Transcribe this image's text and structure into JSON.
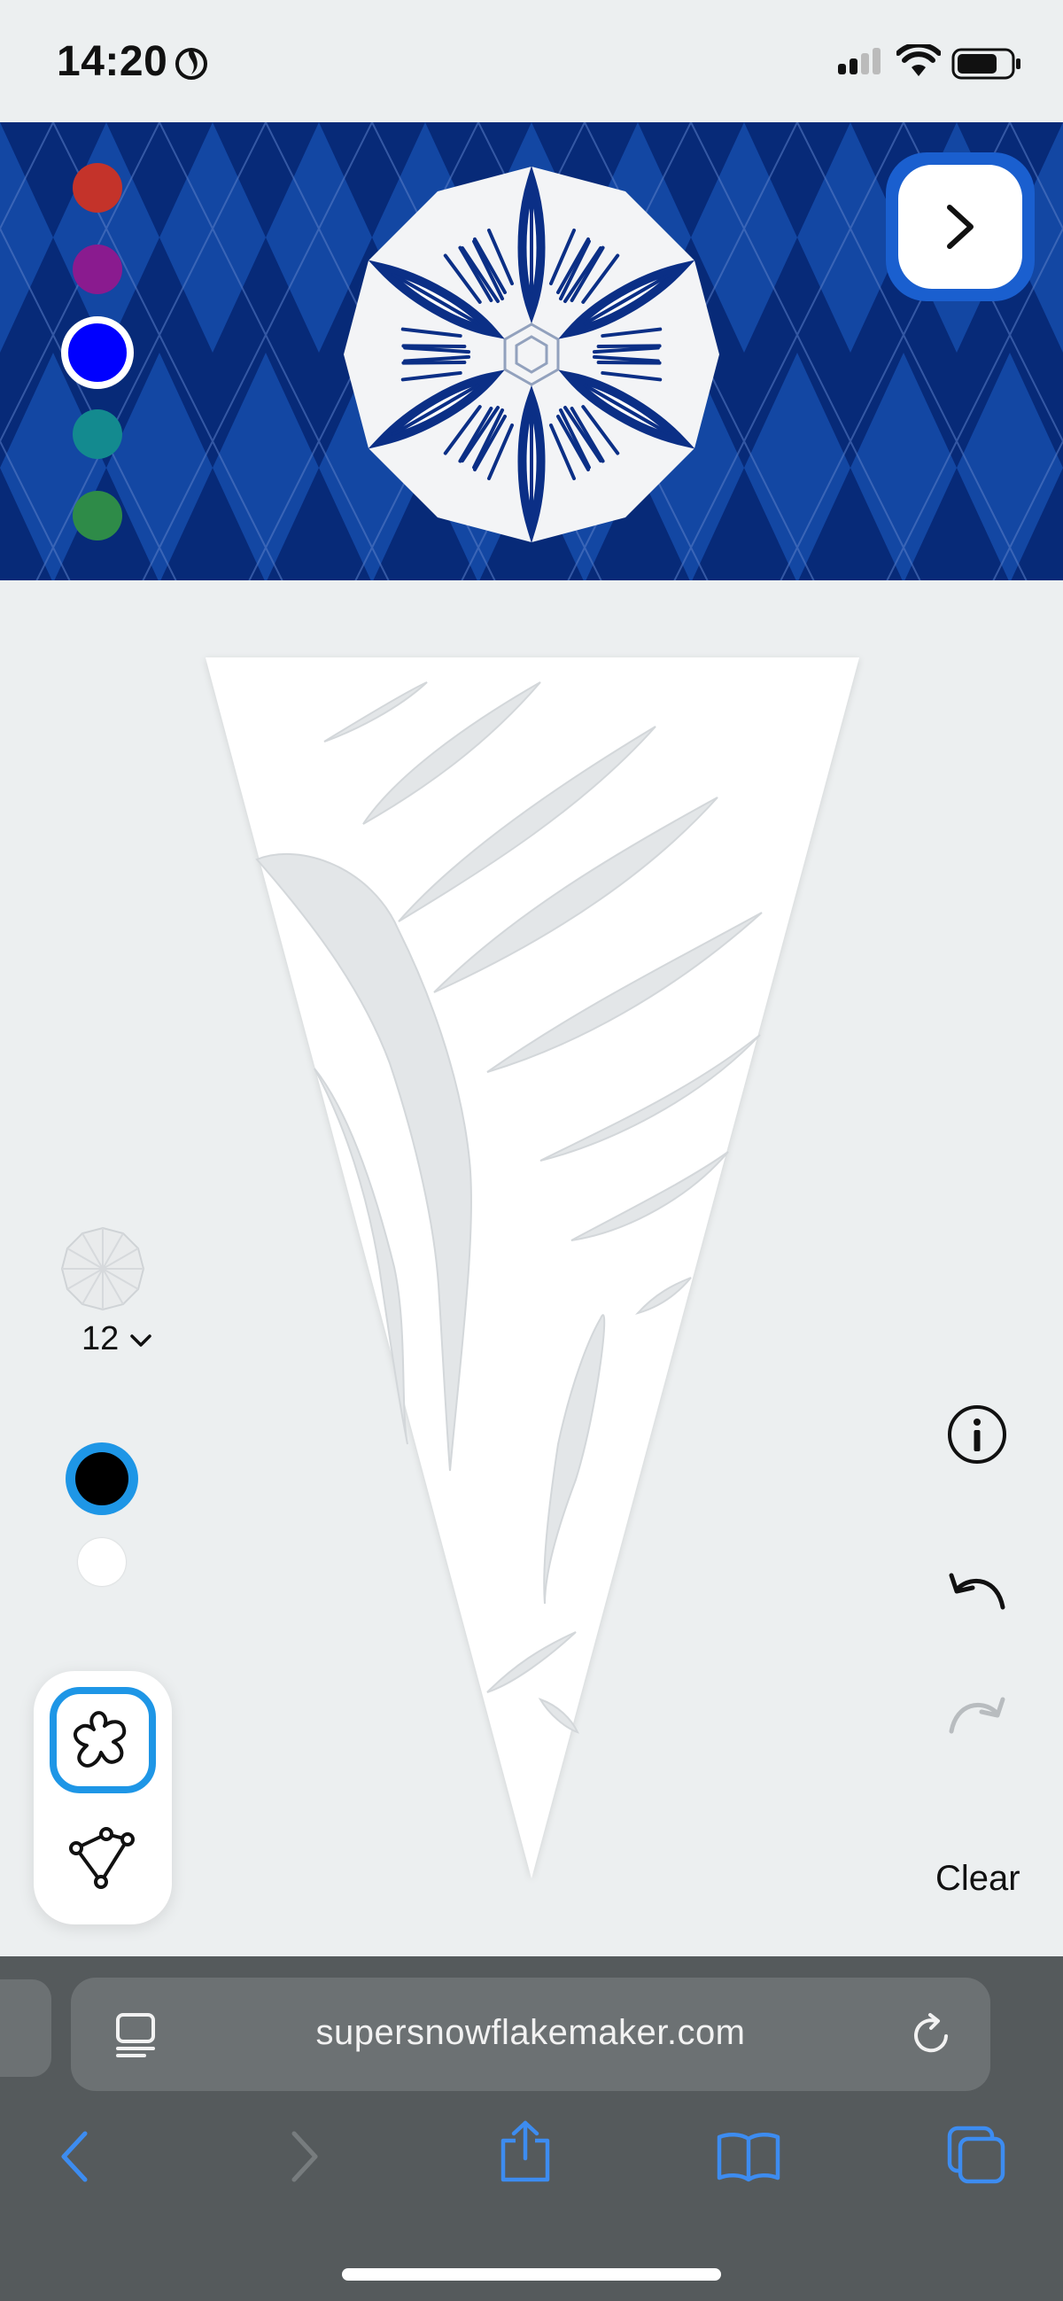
{
  "status_bar": {
    "time": "14:20",
    "icons": [
      "flame-icon",
      "cellular-signal-icon",
      "wifi-icon",
      "battery-icon"
    ]
  },
  "palette": {
    "swatches": [
      {
        "name": "red",
        "color": "#c4332a",
        "selected": false
      },
      {
        "name": "purple",
        "color": "#8a1b8f",
        "selected": false
      },
      {
        "name": "blue",
        "color": "#0000ff",
        "selected": true
      },
      {
        "name": "teal",
        "color": "#138a8f",
        "selected": false
      },
      {
        "name": "green",
        "color": "#2e8b48",
        "selected": false
      }
    ],
    "banner_colors": {
      "dark": "#072a78",
      "light": "#1347a3"
    },
    "next_icon": "chevron-right-icon"
  },
  "folds": {
    "count_label": "12",
    "icon": "fold-preview-icon",
    "dropdown_icon": "chevron-down-icon"
  },
  "cut_colors": [
    {
      "name": "black",
      "color": "#000000",
      "selected": true
    },
    {
      "name": "white",
      "color": "#ffffff",
      "selected": false
    }
  ],
  "tools": [
    {
      "name": "freehand",
      "icon": "freehand-shape-icon",
      "selected": true
    },
    {
      "name": "polygon",
      "icon": "polygon-shape-icon",
      "selected": false
    }
  ],
  "actions": {
    "info_icon": "info-icon",
    "undo_icon": "undo-icon",
    "redo_icon": "redo-icon",
    "clear_label": "Clear"
  },
  "browser": {
    "url": "supersnowflakemaker.com",
    "icons": [
      "reader-icon",
      "reload-icon",
      "back-icon",
      "forward-icon",
      "share-icon",
      "bookmarks-icon",
      "tabs-icon"
    ]
  },
  "accent": "#1e96e6"
}
